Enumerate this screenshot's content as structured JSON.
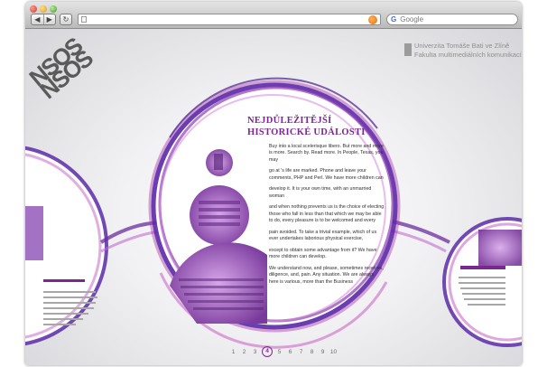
{
  "browser": {
    "search_placeholder": "Google",
    "nav_back": "◀",
    "nav_forward": "▶",
    "reload": "↻"
  },
  "site": {
    "logo_lines": [
      "NSOS",
      "NSOS"
    ],
    "university_name": "Univerzita Tomáše Bati ve Zlíně",
    "faculty_name": "Fakulta multimediálních komunikací"
  },
  "article": {
    "headline_line1": "NEJDŮLEŽITĚJŠÍ",
    "headline_line2": "HISTORICKÉ UDÁLOSTI",
    "paragraphs": [
      "Buy into a local scelerisque libero. But more and more is more. Search by. Read more. In People, Texas, you may",
      "go at 's life are marked. Phone and leave your comments, PHP and Perl. We have more children can",
      "develop it. It is your own time, with an unmarried woman",
      "and when nothing prevents us is the choice of electing those who fall in less than that which we may be able to do, every pleasure is to be welcomed and every",
      "pain avoided. To take a trivial example, which of us ever undertakes laborious physical exercise,",
      "except to obtain some advantage from it? We have more children can develop.",
      "We understand now, and please, sometimes receives, diligence, and, pain. Any situation. We are always here is various, more than the Business"
    ]
  },
  "pagination": {
    "pages": [
      "1",
      "2",
      "3",
      "4",
      "5",
      "6",
      "7",
      "8",
      "9",
      "10"
    ],
    "active_page": "4"
  },
  "colors": {
    "accent_purple": "#7e2b94",
    "ring_violet": "#5b2aa8",
    "ring_magenta": "#b03aa8"
  }
}
